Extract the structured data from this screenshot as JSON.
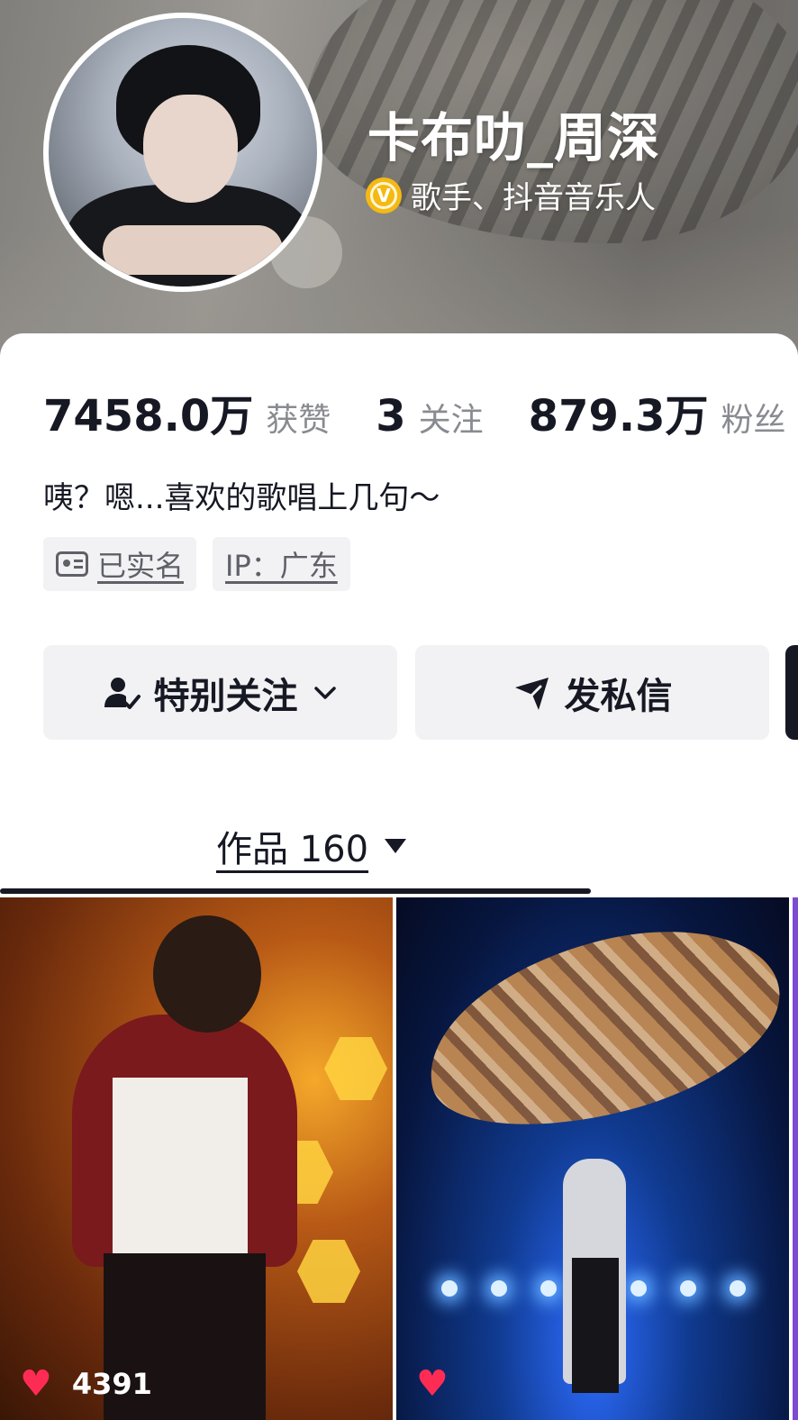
{
  "profile": {
    "nickname": "卡布叻_周深",
    "verify_badge": "V",
    "verify_text": "歌手、抖音音乐人",
    "bio": "咦？嗯...喜欢的歌唱上几句～"
  },
  "stats": [
    {
      "value": "7458.0万",
      "label": "获赞"
    },
    {
      "value": "3",
      "label": "关注"
    },
    {
      "value": "879.3万",
      "label": "粉丝"
    }
  ],
  "tags": [
    {
      "text": "已实名",
      "icon": "id-card-icon"
    },
    {
      "text": "IP：广东"
    }
  ],
  "actions": {
    "special_follow": "特别关注",
    "message": "发私信"
  },
  "tabs": {
    "works_label": "作品 160"
  },
  "videos": [
    {
      "likes": "4391"
    },
    {
      "likes": ""
    }
  ],
  "colors": {
    "accent_red": "#fe2c55",
    "verify_gold": "#f5b914",
    "text_primary": "#161823",
    "text_secondary": "#8a8b91",
    "button_bg": "#f2f2f4"
  }
}
